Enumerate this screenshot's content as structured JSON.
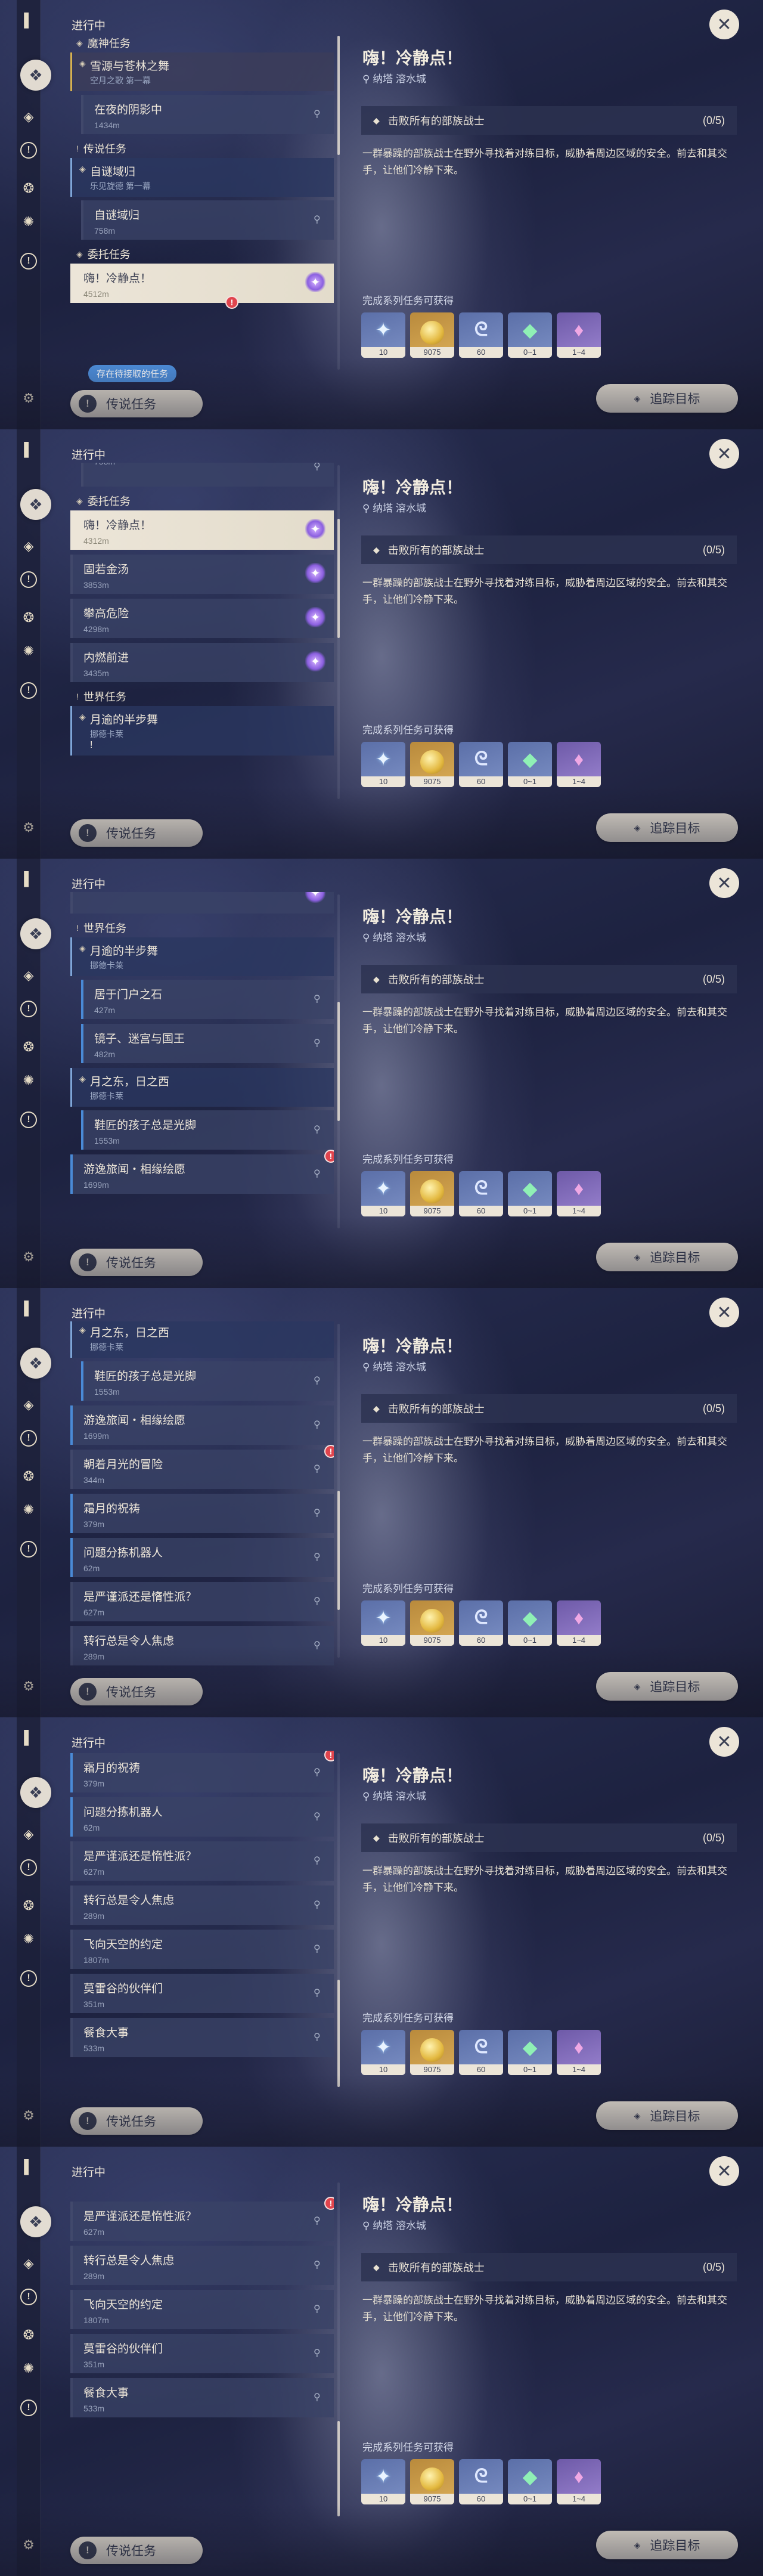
{
  "rail_icons": [
    "quest-book-icon",
    "quest-active-icon",
    "archon-quest-icon",
    "story-quest-icon",
    "world-quest-icon",
    "commission-icon",
    "settings-icon"
  ],
  "list_header": "进行中",
  "categories": {
    "archon": "魔神任务",
    "legend": "传说任务",
    "commission": "委托任务",
    "world": "世界任务"
  },
  "quests": {
    "archon_group": {
      "title": "雪源与苍林之舞",
      "subtitle": "空月之歌 第一幕"
    },
    "night_shadow": {
      "title": "在夜的阴影中",
      "dist": "1434m"
    },
    "legend_group": {
      "title": "自谜域归",
      "subtitle": "乐见旋德 第一幕"
    },
    "mystery_domain": {
      "title": "自谜域归",
      "dist": "758m"
    },
    "calm_down": {
      "title": "嗨！冷静点！",
      "dist": "4512m"
    },
    "selected_calm_down": {
      "title": "嗨！冷静点！",
      "dist": "4312m"
    },
    "hot_soup": {
      "title": "固若金汤",
      "dist": "3853m"
    },
    "climb_adventure": {
      "title": "攀高危险",
      "dist": "4298m"
    },
    "internal_burn": {
      "title": "内燃前进",
      "dist": "3435m"
    },
    "moon_halfstep_group": {
      "title": "月逾的半步舞",
      "subtitle": "挪德卡莱"
    },
    "door_stone": {
      "title": "居于门户之石",
      "dist": "427m"
    },
    "mirror_maze": {
      "title": "镜子、迷宫与国王",
      "dist": "482m"
    },
    "moon_east_group": {
      "title": "月之东，日之西",
      "subtitle": "挪德卡莱"
    },
    "naughty_child": {
      "title": "鞋匠的孩子总是光脚",
      "dist": "1553m"
    },
    "wandering_tour": {
      "title": "游逸旅闻・相缘绘愿",
      "dist": "1699m"
    },
    "moon_adventure": {
      "title": "朝着月光的冒险",
      "dist": "344m"
    },
    "frost_moon_blessing": {
      "title": "霜月的祝祷",
      "dist": "379m"
    },
    "problem_robot": {
      "title": "问题分拣机器人",
      "dist": "62m"
    },
    "strict_or_lazy": {
      "title": "是严谨派还是惰性派？",
      "dist": "627m"
    },
    "transfer_worry": {
      "title": "转行总是令人焦虑",
      "dist": "289m"
    },
    "sky_promise": {
      "title": "飞向天空的约定",
      "dist": "1807m"
    },
    "valley_friends": {
      "title": "莫雷谷的伙伴们",
      "dist": "351m"
    },
    "big_meal": {
      "title": "餐食大事",
      "dist": "533m"
    },
    "prev_partial": {
      "title": "自谜域归",
      "dist": "758m"
    },
    "commission_partial": {
      "dist": "3435m"
    }
  },
  "waiting_tag": "存在待接取的任务",
  "legend_button": "传说任务",
  "detail": {
    "title": "嗨！冷静点！",
    "location": "纳塔  溶水城",
    "objective": "击败所有的部族战士",
    "objective_count": "(0/5)",
    "description": "一群暴躁的部族战士在野外寻找着对练目标，威胁着周边区域的安全。前去和其交手，让他们冷静下来。",
    "rewards_label": "完成系列任务可获得",
    "rewards": [
      {
        "icon": "primogem-icon",
        "qty": "10",
        "rarity": "blue"
      },
      {
        "icon": "mora-icon",
        "qty": "9075",
        "rarity": "gold"
      },
      {
        "icon": "adventure-exp-icon",
        "qty": "60",
        "rarity": "blue"
      },
      {
        "icon": "enhancement-ore-icon",
        "qty": "0~1",
        "rarity": "blue"
      },
      {
        "icon": "crystal-icon",
        "qty": "1~4",
        "rarity": "purple"
      }
    ],
    "track_button": "追踪目标"
  },
  "colors": {
    "selected": "#ece5d8",
    "accent_blue": "#4a8ad6",
    "archon_gold": "#d7b24f",
    "badge_red": "#e0444d",
    "commission_purple": "#8b5fe0"
  }
}
